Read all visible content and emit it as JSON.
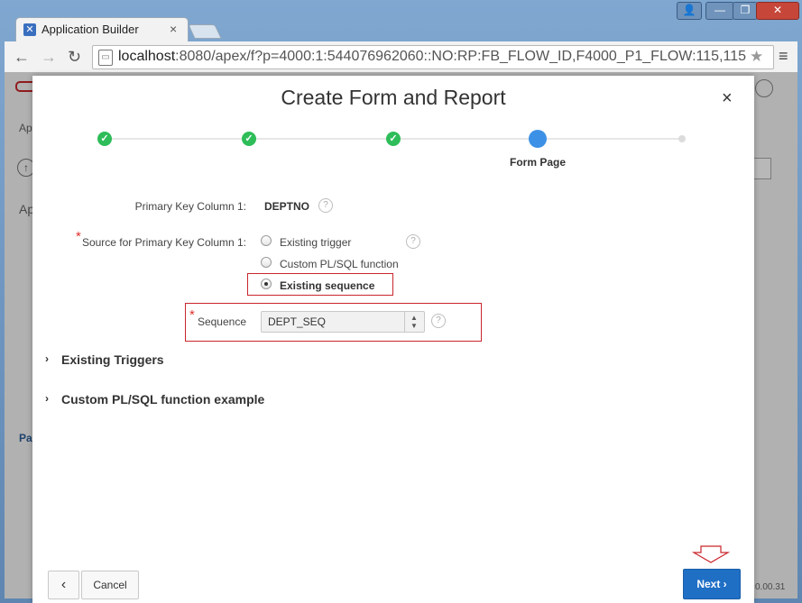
{
  "browser": {
    "tab_title": "Application Builder",
    "tab_close": "×",
    "url_host": "localhost",
    "url_rest": ":8080/apex/f?p=4000:1:544076962060::NO:RP:FB_FLOW_ID,F4000_P1_FLOW:115,115",
    "window_buttons": {
      "user": "👤",
      "minimize": "—",
      "maximize": "❐",
      "close": "✕"
    }
  },
  "background": {
    "left_items": [
      "Ap",
      "Ap",
      "Pa"
    ],
    "version": "0.00.31"
  },
  "dialog": {
    "title": "Create Form and Report",
    "close": "×",
    "steps": [
      {
        "state": "done",
        "label": ""
      },
      {
        "state": "done",
        "label": ""
      },
      {
        "state": "done",
        "label": ""
      },
      {
        "state": "current",
        "label": "Form Page"
      },
      {
        "state": "future",
        "label": ""
      }
    ],
    "pk_label": "Primary Key Column 1:",
    "pk_value": "DEPTNO",
    "source_label": "Source for Primary Key Column 1:",
    "required_mark": "*",
    "radio_options": [
      {
        "label": "Existing trigger",
        "selected": false
      },
      {
        "label": "Custom PL/SQL function",
        "selected": false
      },
      {
        "label": "Existing sequence",
        "selected": true
      }
    ],
    "sequence_label": "Sequence",
    "sequence_value": "DEPT_SEQ",
    "help_glyph": "?",
    "sections": [
      "Existing Triggers",
      "Custom PL/SQL function example"
    ],
    "buttons": {
      "prev": "‹",
      "cancel": "Cancel",
      "next": "Next"
    }
  },
  "colors": {
    "accent": "#1f6fc5",
    "done": "#2ebd59",
    "current": "#3c91e6",
    "highlight_border": "#c9262c"
  }
}
